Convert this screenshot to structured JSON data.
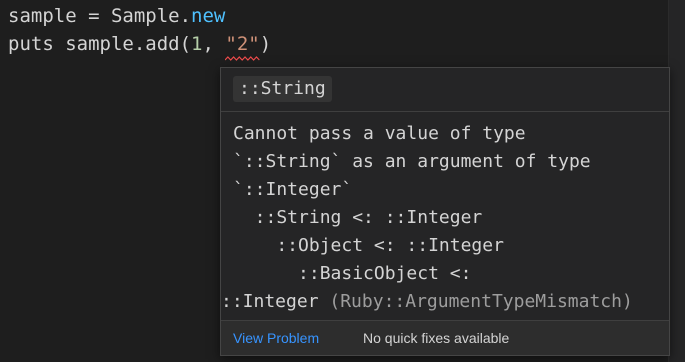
{
  "editor": {
    "line1": {
      "prefix": "sample = Sample.",
      "keyword": "new"
    },
    "line2": {
      "prefix": "puts sample.add(",
      "num_arg": "1",
      "separator": ", ",
      "str_arg": "\"2\"",
      "suffix": ")"
    }
  },
  "hover": {
    "signature": "::String",
    "message_lines": [
      "Cannot pass a value of type",
      "`::String` as an argument of type",
      "`::Integer`",
      "  ::String <: ::Integer",
      "    ::Object <: ::Integer",
      "      ::BasicObject <:"
    ],
    "last_line": {
      "main": "::Integer",
      "code": " (Ruby::ArgumentTypeMismatch)"
    },
    "view_problem_label": "View Problem",
    "no_fixes_label": "No quick fixes available"
  },
  "colors": {
    "background": "#1e1e1e",
    "keyword_new": "#4fc1ff",
    "number": "#b5cea8",
    "string": "#ce9178",
    "error_squiggle": "#f14c4c",
    "link": "#3794ff"
  }
}
